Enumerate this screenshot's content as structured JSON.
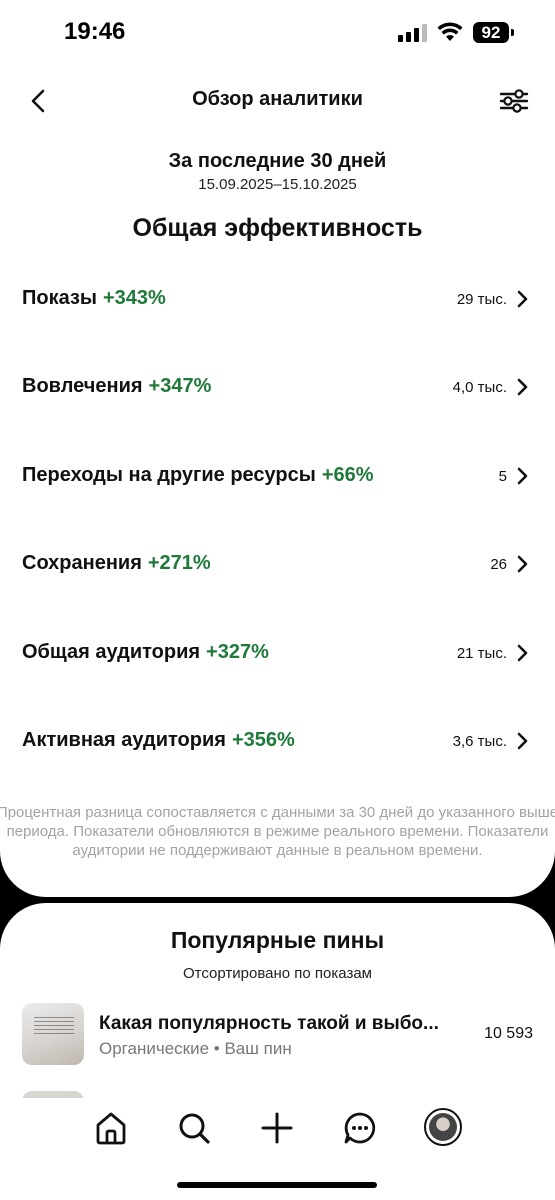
{
  "status_bar": {
    "time": "19:46",
    "battery": "92"
  },
  "header": {
    "title": "Обзор аналитики"
  },
  "period": {
    "label": "За последние 30 дней",
    "dates": "15.09.2025–15.10.2025"
  },
  "section_title": "Общая эффективность",
  "metrics": [
    {
      "label": "Показы",
      "change": "+343%",
      "value": "29 тыс."
    },
    {
      "label": "Вовлечения",
      "change": "+347%",
      "value": "4,0 тыс."
    },
    {
      "label": "Переходы на другие ресурсы",
      "change": "+66%",
      "value": "5"
    },
    {
      "label": "Сохранения",
      "change": "+271%",
      "value": "26"
    },
    {
      "label": "Общая аудитория",
      "change": "+327%",
      "value": "21 тыс."
    },
    {
      "label": "Активная аудитория",
      "change": "+356%",
      "value": "3,6 тыс."
    }
  ],
  "footnote": "Процентная разница сопоставляется с данными за 30 дней до указанного выше периода. Показатели обновляются в режиме реального времени. Показатели аудитории не поддерживают данные в реальном времени.",
  "popular_pins": {
    "title": "Популярные пины",
    "subtitle": "Отсортировано по показам",
    "items": [
      {
        "title": "Какая популярность такой и выбо...",
        "source": "Органические",
        "separator": "•",
        "owner": "Ваш пин",
        "count": "10 593"
      }
    ]
  },
  "colors": {
    "positive": "#1f7a3a",
    "footnote": "#a3a3a3"
  },
  "icons": [
    "back-icon",
    "filter-sliders-icon",
    "chevron-right-icon",
    "home-icon",
    "search-icon",
    "plus-icon",
    "messages-icon",
    "avatar"
  ]
}
